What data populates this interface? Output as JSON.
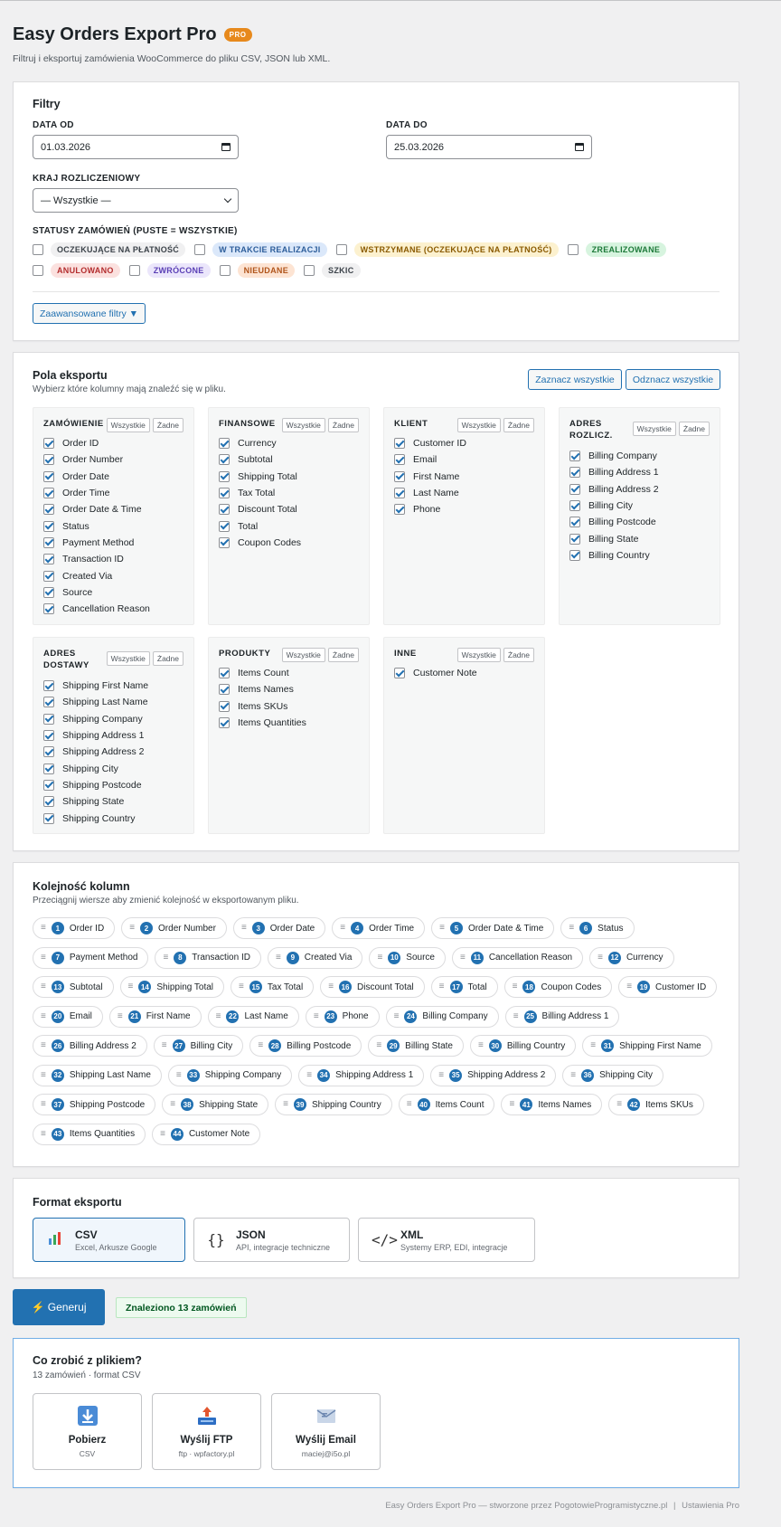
{
  "header": {
    "title": "Easy Orders Export Pro",
    "badge": "PRO",
    "subtitle": "Filtruj i eksportuj zamówienia WooCommerce do pliku CSV, JSON lub XML."
  },
  "filters": {
    "title": "Filtry",
    "date_from_label": "DATA OD",
    "date_from_value": "01.03.2026",
    "date_to_label": "DATA DO",
    "date_to_value": "25.03.2026",
    "country_label": "KRAJ ROZLICZENIOWY",
    "country_value": "— Wszystkie —",
    "statuses_label": "STATUSY ZAMÓWIEŃ (PUSTE = WSZYSTKIE)",
    "statuses": [
      {
        "label": "OCZEKUJĄCE NA PŁATNOŚĆ",
        "bg": "#f0f0f1",
        "fg": "#3c434a",
        "checkbox": true
      },
      {
        "label": "W TRAKCIE REALIZACJI",
        "bg": "#dbe8fa",
        "fg": "#2c5d9a",
        "checkbox": true
      },
      {
        "label": "WSTRZYMANE (OCZEKUJĄCE NA PŁATNOŚĆ)",
        "bg": "#fcf1cf",
        "fg": "#8a5a00",
        "checkbox": true
      },
      {
        "label": "ZREALIZOWANE",
        "bg": "#d7f4df",
        "fg": "#1e7a3a",
        "checkbox": true
      },
      {
        "label": "ANULOWANO",
        "bg": "#fbe1df",
        "fg": "#b32d2e",
        "checkbox": true
      },
      {
        "label": "ZWRÓCONE",
        "bg": "#ebe6fb",
        "fg": "#5a3fb5",
        "checkbox": true
      },
      {
        "label": "NIEUDANE",
        "bg": "#fde4d3",
        "fg": "#b0541a",
        "checkbox": true
      },
      {
        "label": "SZKIC",
        "bg": "#f0f0f1",
        "fg": "#3c434a",
        "checkbox": true
      }
    ],
    "advanced_label": "Zaawansowane filtry ▼"
  },
  "fields": {
    "title": "Pola eksportu",
    "subtitle": "Wybierz które kolumny mają znaleźć się w pliku.",
    "select_all": "Zaznacz wszystkie",
    "deselect_all": "Odznacz wszystkie",
    "all_label": "Wszystkie",
    "none_label": "Żadne",
    "groups": [
      {
        "name": "ZAMÓWIENIE",
        "items": [
          "Order ID",
          "Order Number",
          "Order Date",
          "Order Time",
          "Order Date & Time",
          "Status",
          "Payment Method",
          "Transaction ID",
          "Created Via",
          "Source",
          "Cancellation Reason"
        ]
      },
      {
        "name": "FINANSOWE",
        "items": [
          "Currency",
          "Subtotal",
          "Shipping Total",
          "Tax Total",
          "Discount Total",
          "Total",
          "Coupon Codes"
        ]
      },
      {
        "name": "KLIENT",
        "items": [
          "Customer ID",
          "Email",
          "First Name",
          "Last Name",
          "Phone"
        ]
      },
      {
        "name": "ADRES ROZLICZ.",
        "items": [
          "Billing Company",
          "Billing Address 1",
          "Billing Address 2",
          "Billing City",
          "Billing Postcode",
          "Billing State",
          "Billing Country"
        ]
      },
      {
        "name": "ADRES DOSTAWY",
        "items": [
          "Shipping First Name",
          "Shipping Last Name",
          "Shipping Company",
          "Shipping Address 1",
          "Shipping Address 2",
          "Shipping City",
          "Shipping Postcode",
          "Shipping State",
          "Shipping Country"
        ]
      },
      {
        "name": "PRODUKTY",
        "items": [
          "Items Count",
          "Items Names",
          "Items SKUs",
          "Items Quantities"
        ]
      },
      {
        "name": "INNE",
        "items": [
          "Customer Note"
        ]
      }
    ]
  },
  "order": {
    "title": "Kolejność kolumn",
    "subtitle": "Przeciągnij wiersze aby zmienić kolejność w eksportowanym pliku.",
    "columns": [
      "Order ID",
      "Order Number",
      "Order Date",
      "Order Time",
      "Order Date & Time",
      "Status",
      "Payment Method",
      "Transaction ID",
      "Created Via",
      "Source",
      "Cancellation Reason",
      "Currency",
      "Subtotal",
      "Shipping Total",
      "Tax Total",
      "Discount Total",
      "Total",
      "Coupon Codes",
      "Customer ID",
      "Email",
      "First Name",
      "Last Name",
      "Phone",
      "Billing Company",
      "Billing Address 1",
      "Billing Address 2",
      "Billing City",
      "Billing Postcode",
      "Billing State",
      "Billing Country",
      "Shipping First Name",
      "Shipping Last Name",
      "Shipping Company",
      "Shipping Address 1",
      "Shipping Address 2",
      "Shipping City",
      "Shipping Postcode",
      "Shipping State",
      "Shipping Country",
      "Items Count",
      "Items Names",
      "Items SKUs",
      "Items Quantities",
      "Customer Note"
    ]
  },
  "format": {
    "title": "Format eksportu",
    "options": [
      {
        "icon": "bar-chart-icon",
        "title": "CSV",
        "desc": "Excel, Arkusze Google",
        "active": true
      },
      {
        "icon": "braces-icon",
        "title": "JSON",
        "desc": "API, integracje techniczne",
        "active": false
      },
      {
        "icon": "code-icon",
        "title": "XML",
        "desc": "Systemy ERP, EDI, integracje",
        "active": false
      }
    ]
  },
  "generate": {
    "label": "⚡ Generuj",
    "found": "Znaleziono 13 zamówień"
  },
  "result": {
    "title": "Co zrobić z plikiem?",
    "subtitle": "13 zamówień · format CSV",
    "actions": [
      {
        "icon": "download-icon",
        "title": "Pobierz",
        "sub": "CSV"
      },
      {
        "icon": "upload-icon",
        "title": "Wyślij FTP",
        "sub": "ftp · wpfactory.pl"
      },
      {
        "icon": "email-icon",
        "title": "Wyślij Email",
        "sub": "maciej@i5o.pl"
      }
    ]
  },
  "footer": {
    "text": "Easy Orders Export Pro — stworzone przez PogotowieProgramistyczne.pl",
    "separator": "|",
    "link": "Ustawienia Pro"
  }
}
